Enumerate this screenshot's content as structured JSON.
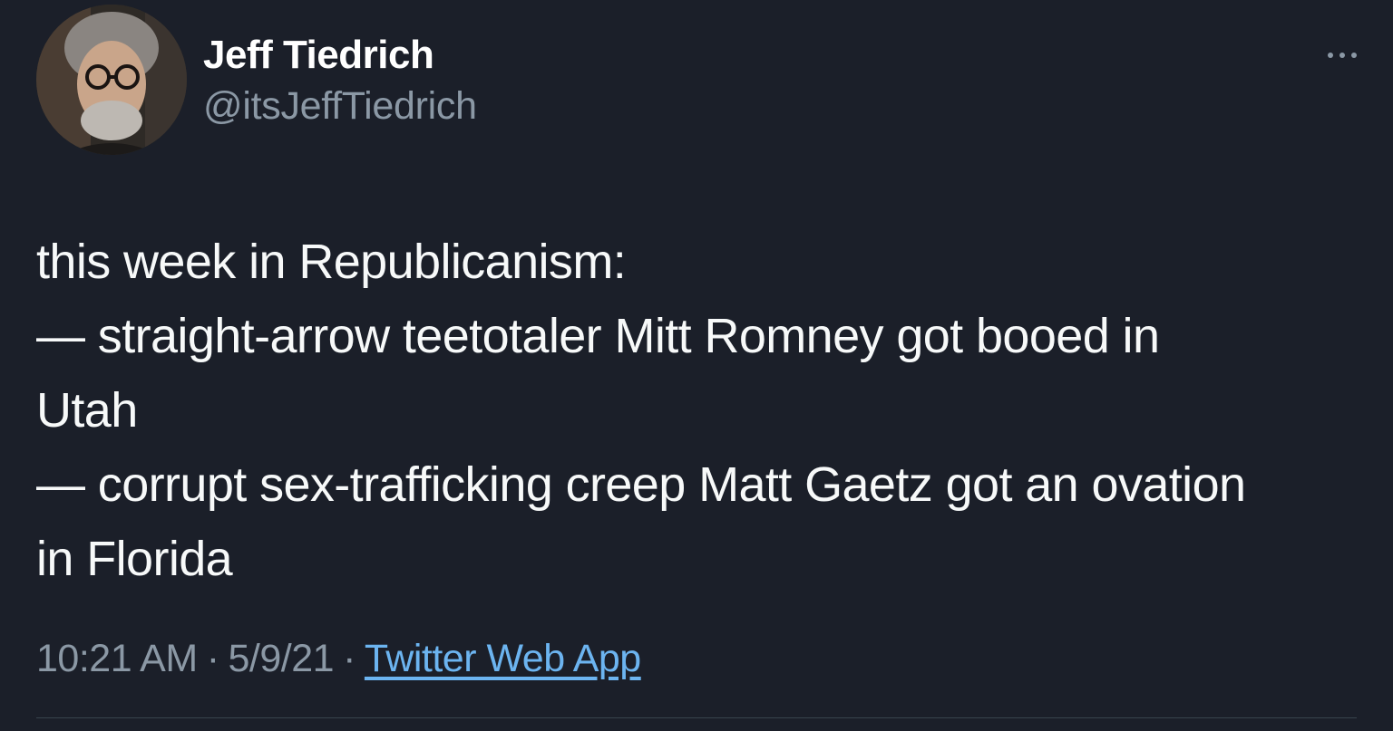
{
  "user": {
    "display_name": "Jeff Tiedrich",
    "handle": "@itsJeffTiedrich"
  },
  "tweet": {
    "lines": [
      "this week in Republicanism:",
      "— straight-arrow teetotaler Mitt Romney got booed in",
      "Utah",
      "— corrupt sex-trafficking creep Matt Gaetz got an ovation",
      "in Florida"
    ]
  },
  "meta": {
    "time": "10:21 AM",
    "separator": "·",
    "date": "5/9/21",
    "source": "Twitter Web App"
  },
  "icons": {
    "more": "more-horizontal-icon",
    "avatar": "profile-avatar"
  },
  "colors": {
    "background": "#1b1f29",
    "text_primary": "#f7f9f9",
    "text_secondary": "#8b98a5",
    "link": "#6cb4f0",
    "divider": "#38444d"
  }
}
